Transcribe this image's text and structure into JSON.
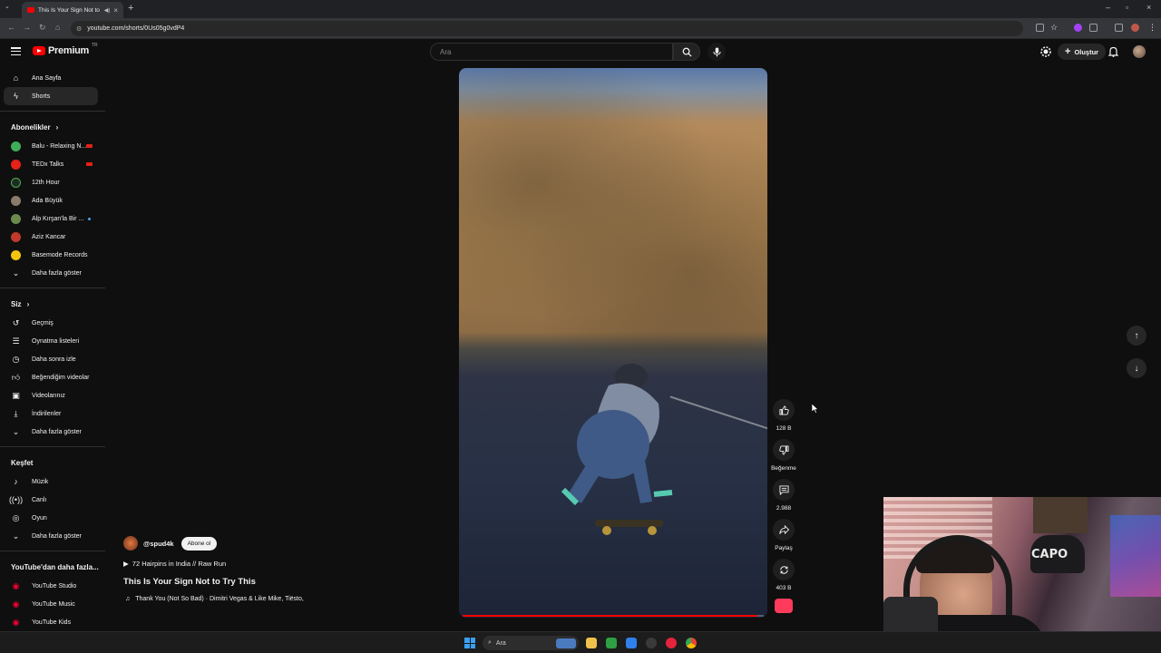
{
  "browser": {
    "tab_title": "This Is Your Sign Not to Try",
    "url": "youtube.com/shorts/0Us05g0vdP4"
  },
  "header": {
    "logo_text": "Premium",
    "logo_region": "TR",
    "search_placeholder": "Ara",
    "create_label": "Oluştur"
  },
  "sidebar": {
    "main": [
      {
        "label": "Ana Sayfa",
        "icon": "home-icon"
      },
      {
        "label": "Shorts",
        "icon": "shorts-icon"
      }
    ],
    "subscriptions_title": "Abonelikler",
    "subscriptions": [
      {
        "label": "Balu - Relaxing N...",
        "color": "#3fae5a",
        "live": true
      },
      {
        "label": "TEDx Talks",
        "color": "#e62117",
        "live": true
      },
      {
        "label": "12th Hour",
        "color": "#1e2d24",
        "live": false
      },
      {
        "label": "Ada Büyük",
        "color": "#8c7a6a",
        "live": false
      },
      {
        "label": "Alp Kırşan'la Bir ...",
        "color": "#6a8b4d",
        "new": true
      },
      {
        "label": "Aziz Kancar",
        "color": "#c0392b",
        "live": false
      },
      {
        "label": "Basemode Records",
        "color": "#f1c40f",
        "live": false
      }
    ],
    "show_more": "Daha fazla göster",
    "you_title": "Siz",
    "you_items": [
      {
        "label": "Geçmiş",
        "icon": "history-icon"
      },
      {
        "label": "Oynatma listeleri",
        "icon": "playlists-icon"
      },
      {
        "label": "Daha sonra izle",
        "icon": "watch-later-icon"
      },
      {
        "label": "Beğendiğim videolar",
        "icon": "liked-icon"
      },
      {
        "label": "Videolarınız",
        "icon": "your-videos-icon"
      },
      {
        "label": "İndirilenler",
        "icon": "download-icon"
      }
    ],
    "explore_title": "Keşfet",
    "explore_items": [
      {
        "label": "Müzik",
        "icon": "music-icon"
      },
      {
        "label": "Canlı",
        "icon": "live-icon"
      },
      {
        "label": "Oyun",
        "icon": "gaming-icon"
      }
    ],
    "more_title": "YouTube'dan daha fazla...",
    "more_items": [
      {
        "label": "YouTube Studio"
      },
      {
        "label": "YouTube Music"
      },
      {
        "label": "YouTube Kids"
      }
    ]
  },
  "short": {
    "channel": "@spud4k",
    "subscribe_label": "Abone ol",
    "playlist": "72 Hairpins in India // Raw Run",
    "title": "This Is Your Sign Not to Try This",
    "music": "Thank You (Not So Bad) · Dimitri Vegas & Like Mike, Tiësto,",
    "progress": 0.98
  },
  "actions": {
    "likes": "128 B",
    "dislike_label": "Beğenme",
    "comments": "2.988",
    "share_label": "Paylaş",
    "remix": "403 B"
  },
  "webcam": {
    "cap_text": "CAPO"
  },
  "taskbar": {
    "search_label": "Ara"
  }
}
